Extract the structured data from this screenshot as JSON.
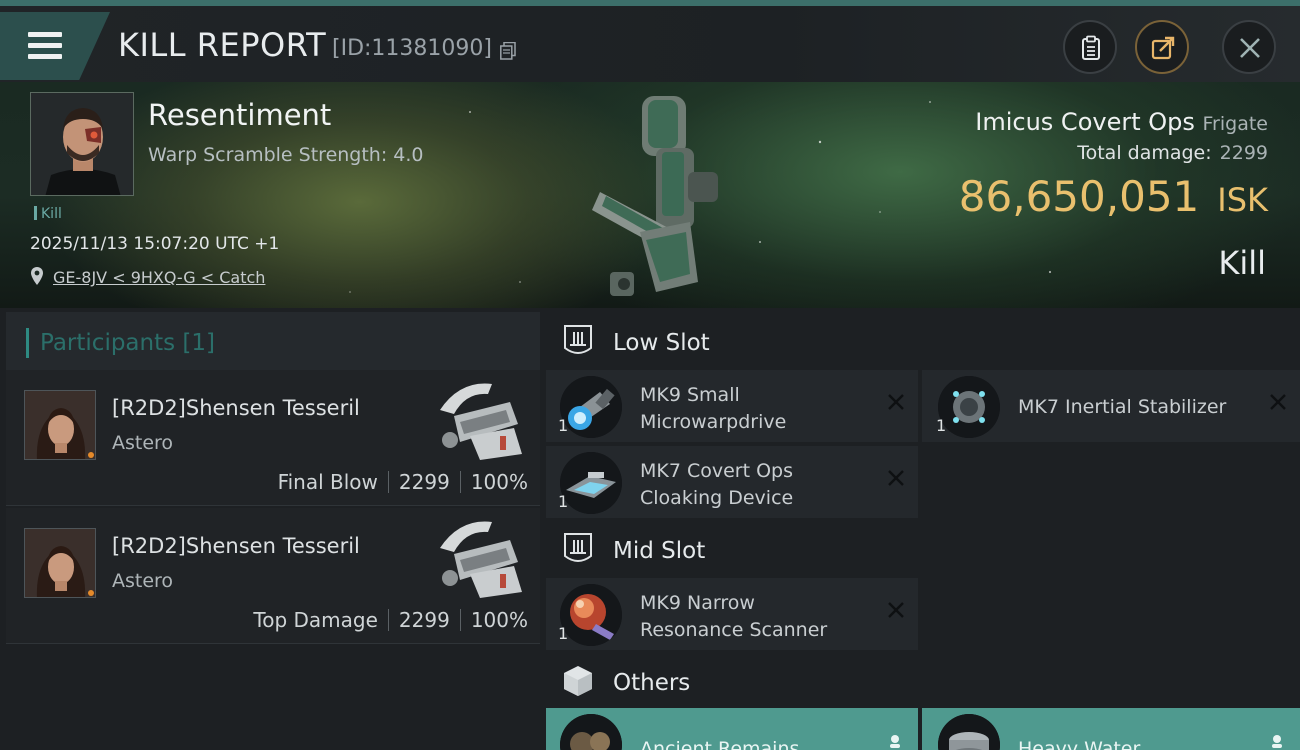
{
  "header": {
    "title": "KILL REPORT",
    "kill_id": "[ID:11381090]"
  },
  "victim": {
    "pilot": "Resentiment",
    "warp_scramble": "Warp Scramble Strength: 4.0",
    "tag": "Kill",
    "datetime": "2025/11/13 15:07:20 UTC +1",
    "location": "GE-8JV < 9HXQ-G < Catch",
    "ship_name": "Imicus Covert Ops",
    "ship_class": "Frigate",
    "total_damage_label": "Total damage:",
    "total_damage": "2299",
    "isk_value": "86,650,051",
    "isk_unit": "ISK",
    "result": "Kill"
  },
  "participants": {
    "header": "Participants [1]",
    "rows": [
      {
        "name": "[R2D2]Shensen Tesseril",
        "ship": "Astero",
        "role": "Final Blow",
        "damage": "2299",
        "percent": "100%"
      },
      {
        "name": "[R2D2]Shensen Tesseril",
        "ship": "Astero",
        "role": "Top Damage",
        "damage": "2299",
        "percent": "100%"
      }
    ]
  },
  "slots": {
    "low": {
      "label": "Low Slot",
      "items": [
        {
          "line1": "MK9 Small",
          "line2": "Microwarpdrive",
          "qty": "1"
        },
        {
          "line1": "MK7 Inertial Stabilizer",
          "line2": "",
          "qty": "1"
        },
        {
          "line1": "MK7 Covert Ops",
          "line2": "Cloaking Device",
          "qty": "1"
        }
      ]
    },
    "mid": {
      "label": "Mid Slot",
      "items": [
        {
          "line1": "MK9 Narrow",
          "line2": "Resonance Scanner",
          "qty": "1"
        }
      ]
    },
    "others": {
      "label": "Others",
      "items": [
        {
          "line1": "Ancient Remains"
        },
        {
          "line1": "Heavy Water"
        }
      ]
    }
  },
  "colors": {
    "accent": "#2e8a82",
    "isk": "#e9c06e",
    "other_item_bg": "#4f9a8f"
  },
  "icons": {
    "menu": "hamburger-icon",
    "copy": "copy-icon",
    "clipboard": "clipboard-icon",
    "share": "share-icon",
    "close": "close-icon",
    "location": "location-pin-icon",
    "slot": "slot-shield-icon",
    "others": "cube-icon",
    "remove": "remove-x-icon"
  }
}
